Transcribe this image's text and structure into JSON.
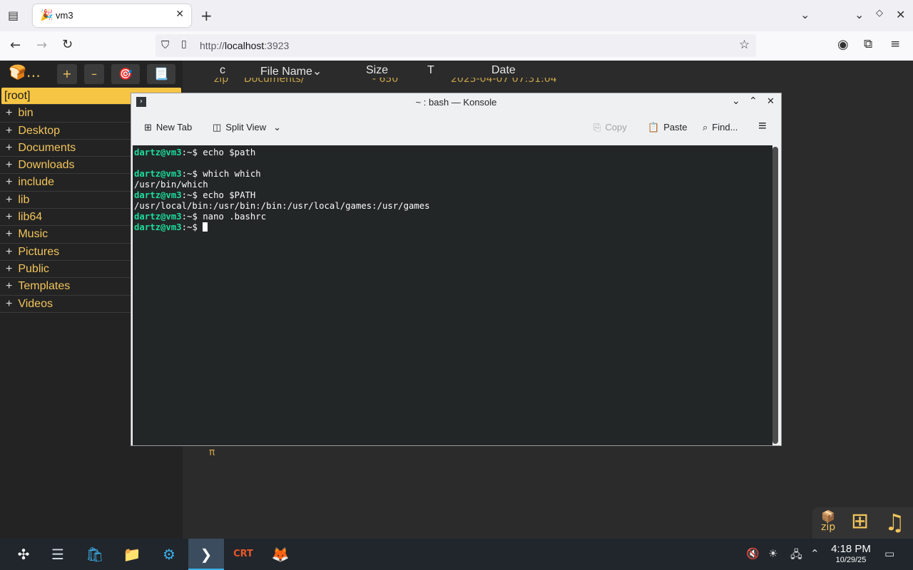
{
  "browser": {
    "tab_title": "vm3",
    "tab_favicon": "🎉",
    "url_prefix": "http://",
    "url_host": "localhost",
    "url_port": ":3923"
  },
  "sidebar": {
    "toolbar_logo": "🍞…",
    "toolbar_plus": "+",
    "toolbar_minus": "–",
    "toolbar_target": "🎯",
    "toolbar_doc": "📃",
    "root_label": "[root]",
    "items": [
      "bin",
      "Desktop",
      "Documents",
      "Downloads",
      "include",
      "lib",
      "lib64",
      "Music",
      "Pictures",
      "Public",
      "Templates",
      "Videos"
    ]
  },
  "listing": {
    "headers": [
      "c",
      "File Name⌄",
      "Size",
      "T",
      "Date"
    ],
    "peek_row": [
      "zip",
      "Documents/",
      "- 650",
      "",
      "2025-04-07 07:31:04"
    ],
    "footer_symbol": "π"
  },
  "konsole": {
    "title": "~ : bash — Konsole",
    "toolbar": {
      "new_tab": "New Tab",
      "split_view": "Split View",
      "copy": "Copy",
      "paste": "Paste",
      "find": "Find..."
    },
    "prompt_user": "dartz@vm3",
    "prompt_tail": ":~$ ",
    "lines": [
      {
        "type": "prompt",
        "cmd": "echo $path"
      },
      {
        "type": "output",
        "text": ""
      },
      {
        "type": "prompt",
        "cmd": "which which"
      },
      {
        "type": "output",
        "text": "/usr/bin/which"
      },
      {
        "type": "prompt",
        "cmd": "echo $PATH"
      },
      {
        "type": "output",
        "text": "/usr/local/bin:/usr/bin:/bin:/usr/local/games:/usr/games"
      },
      {
        "type": "prompt",
        "cmd": "nano .bashrc"
      },
      {
        "type": "prompt",
        "cmd": ""
      }
    ]
  },
  "corner_widget": {
    "zip_label": "zip"
  },
  "taskbar": {
    "time": "4:18 PM",
    "date": "10/29/25"
  }
}
